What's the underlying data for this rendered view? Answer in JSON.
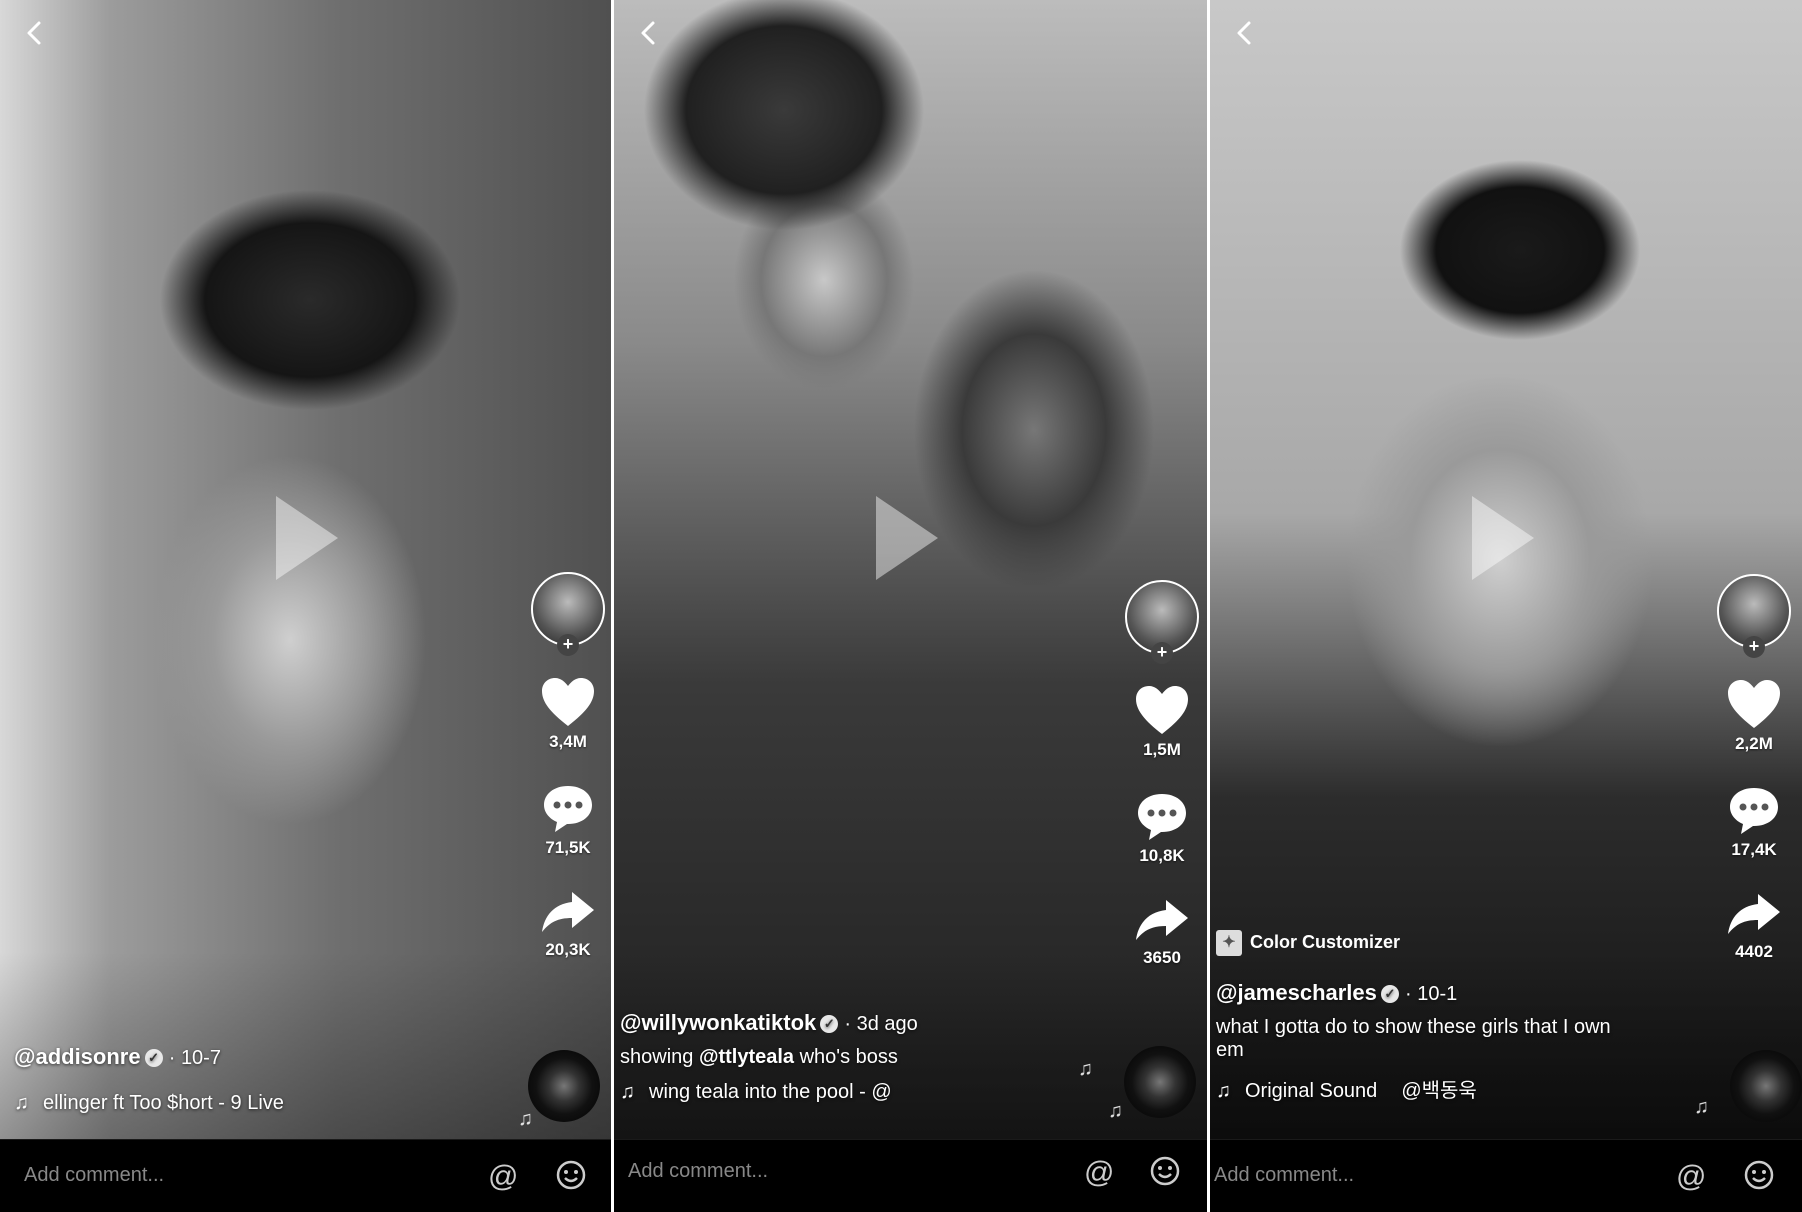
{
  "panels": [
    {
      "username": "@addisonre",
      "date": "10-7",
      "caption_prefix": "",
      "caption_mention": "",
      "caption_suffix": "",
      "music": "ellinger ft Too $hort - 9 Live",
      "effect": "",
      "likes": "3,4M",
      "comments": "71,5K",
      "shares": "20,3K",
      "comment_placeholder": "Add comment..."
    },
    {
      "username": "@willywonkatiktok",
      "date": "3d ago",
      "caption_prefix": "showing ",
      "caption_mention": "@ttlyteala",
      "caption_suffix": " who's boss",
      "music": "wing teala into the pool - @",
      "effect": "",
      "likes": "1,5M",
      "comments": "10,8K",
      "shares": "3650",
      "comment_placeholder": "Add comment..."
    },
    {
      "username": "@jamescharles",
      "date": "10-1",
      "caption_prefix": "what I gotta do to show these girls that I own",
      "caption_line2": "em",
      "music": "Original Sound",
      "music_extra": "@백동욱",
      "effect": "Color Customizer",
      "likes": "2,2M",
      "comments": "17,4K",
      "shares": "4402",
      "comment_placeholder": "Add comment..."
    }
  ],
  "colors": {
    "background": "#000000",
    "text": "#ffffff",
    "placeholder": "#888888"
  },
  "icons": [
    "back-chevron-icon",
    "play-icon",
    "heart-icon",
    "comment-bubble-icon",
    "share-arrow-icon",
    "music-note-icon",
    "at-mention-icon",
    "emoji-smile-icon",
    "music-disc-icon"
  ]
}
